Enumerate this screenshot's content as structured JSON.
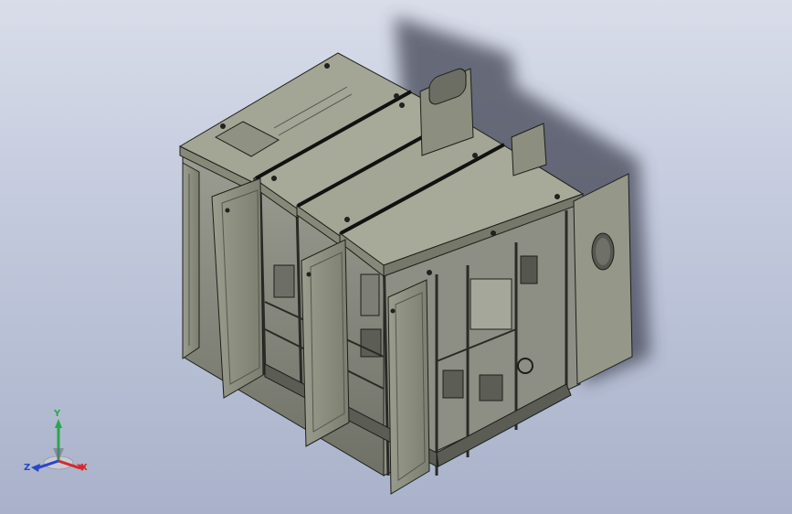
{
  "viewport": {
    "background_top": "#d9dde9",
    "background_bottom": "#a9b2ca"
  },
  "model": {
    "subject": "electrical-cabinet-assembly",
    "cabinet_count": 4,
    "door_count": 4,
    "side_panel_count": 2,
    "colors": {
      "roof_top": "#a3a595",
      "roof_front": "#878978",
      "frame": "#7b7d70",
      "door": "#8e9081",
      "outline": "#1e1f1b",
      "shadow": "#3c4150"
    }
  },
  "triad": {
    "y_label": "Y",
    "x_label": "X",
    "z_label": "Z",
    "y_color": "#27a84a",
    "x_color": "#d8282b",
    "z_color": "#2846c8"
  }
}
